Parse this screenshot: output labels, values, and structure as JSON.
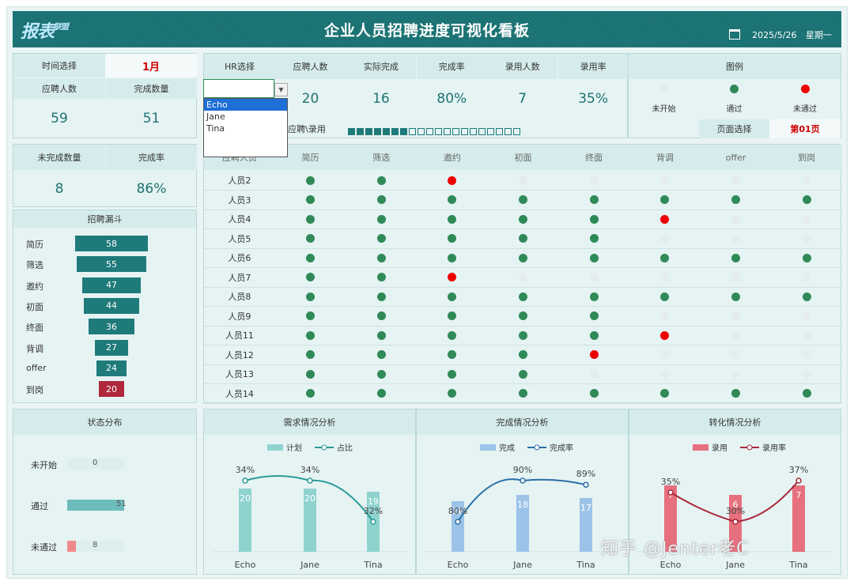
{
  "header": {
    "logo_main": "报表",
    "logo_sub": "联盟",
    "title": "企业人员招聘进度可视化看板",
    "date": "2025/5/26",
    "weekday": "星期一"
  },
  "summary": {
    "time_label": "时间选择",
    "time_value": "1月",
    "applicants_label": "应聘人数",
    "applicants_value": "59",
    "done_label": "完成数量",
    "done_value": "51",
    "undone_label": "未完成数量",
    "undone_value": "8",
    "rate_label": "完成率",
    "rate_value": "86%"
  },
  "hr": {
    "select_label": "HR选择",
    "cols": [
      "应聘人数",
      "实际完成",
      "完成率",
      "录用人数",
      "录用率"
    ],
    "values": [
      "20",
      "16",
      "80%",
      "7",
      "35%"
    ],
    "options": [
      "Echo",
      "Jane",
      "Tina"
    ],
    "selected": "Echo",
    "progress_label": "应聘\\录用",
    "progress_filled": 7,
    "progress_total": 20,
    "page_label": "页面选择",
    "page_value": "第01页"
  },
  "legend": {
    "title": "图例",
    "items": [
      "未开始",
      "通过",
      "未通过"
    ]
  },
  "table": {
    "columns": [
      "应聘人员",
      "简历",
      "筛选",
      "邀约",
      "初面",
      "终面",
      "背调",
      "offer",
      "到岗"
    ],
    "rows": [
      {
        "name": "人员2",
        "s": [
          "g",
          "g",
          "r",
          "e",
          "e",
          "e",
          "e",
          "e"
        ]
      },
      {
        "name": "人员3",
        "s": [
          "g",
          "g",
          "g",
          "g",
          "g",
          "g",
          "g",
          "g"
        ]
      },
      {
        "name": "人员4",
        "s": [
          "g",
          "g",
          "g",
          "g",
          "g",
          "r",
          "e",
          "e"
        ]
      },
      {
        "name": "人员5",
        "s": [
          "g",
          "g",
          "g",
          "g",
          "g",
          "e",
          "e",
          "e"
        ]
      },
      {
        "name": "人员6",
        "s": [
          "g",
          "g",
          "g",
          "g",
          "g",
          "g",
          "g",
          "g"
        ]
      },
      {
        "name": "人员7",
        "s": [
          "g",
          "g",
          "r",
          "e",
          "e",
          "e",
          "e",
          "e"
        ]
      },
      {
        "name": "人员8",
        "s": [
          "g",
          "g",
          "g",
          "g",
          "g",
          "g",
          "g",
          "g"
        ]
      },
      {
        "name": "人员9",
        "s": [
          "g",
          "g",
          "g",
          "g",
          "g",
          "e",
          "e",
          "e"
        ]
      },
      {
        "name": "人员11",
        "s": [
          "g",
          "g",
          "g",
          "g",
          "g",
          "r",
          "e",
          "e"
        ]
      },
      {
        "name": "人员12",
        "s": [
          "g",
          "g",
          "g",
          "g",
          "r",
          "e",
          "e",
          "e"
        ]
      },
      {
        "name": "人员13",
        "s": [
          "g",
          "g",
          "g",
          "g",
          "e",
          "e",
          "e",
          "e"
        ]
      },
      {
        "name": "人员14",
        "s": [
          "g",
          "g",
          "g",
          "g",
          "g",
          "g",
          "g",
          "g"
        ]
      }
    ]
  },
  "funnel": {
    "title": "招聘漏斗",
    "stages": [
      "简历",
      "筛选",
      "邀约",
      "初面",
      "终面",
      "背调",
      "offer",
      "到岗"
    ],
    "values": [
      58,
      55,
      47,
      44,
      36,
      27,
      24,
      20
    ]
  },
  "status": {
    "title": "状态分布",
    "labels": [
      "未开始",
      "通过",
      "未通过"
    ],
    "values": [
      0,
      51,
      8
    ]
  },
  "chart_data": [
    {
      "type": "bar",
      "title": "需求情况分析",
      "categories": [
        "Echo",
        "Jane",
        "Tina"
      ],
      "series": [
        {
          "name": "计划",
          "values": [
            20,
            20,
            19
          ]
        },
        {
          "name": "占比",
          "values": [
            "34%",
            "34%",
            "32%"
          ]
        }
      ],
      "color": "#8fd3cf",
      "line_color": "#2a9a98"
    },
    {
      "type": "bar",
      "title": "完成情况分析",
      "categories": [
        "Echo",
        "Jane",
        "Tina"
      ],
      "series": [
        {
          "name": "完成",
          "values": [
            16,
            18,
            17
          ]
        },
        {
          "name": "完成率",
          "values": [
            "80%",
            "90%",
            "89%"
          ]
        }
      ],
      "color": "#9cc3e8",
      "line_color": "#2a6fa8"
    },
    {
      "type": "bar",
      "title": "转化情况分析",
      "categories": [
        "Echo",
        "Jane",
        "Tina"
      ],
      "series": [
        {
          "name": "录用",
          "values": [
            7,
            6,
            7
          ]
        },
        {
          "name": "录用率",
          "values": [
            "35%",
            "30%",
            "37%"
          ]
        }
      ],
      "color": "#e7707e",
      "line_color": "#a8283a"
    }
  ],
  "watermark": "知乎 @Jenter老C"
}
